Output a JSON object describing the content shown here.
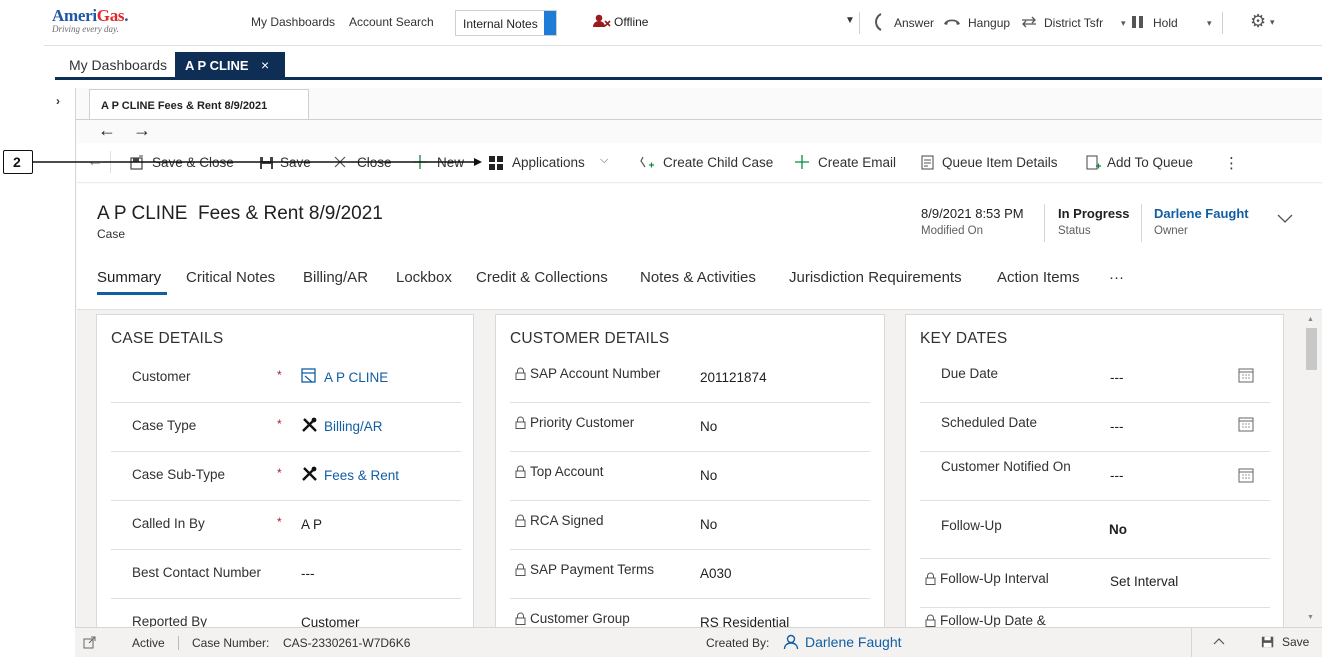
{
  "topbar": {
    "brand_ameri": "Ameri",
    "brand_gas": "Gas",
    "brand_dot": ".",
    "tagline": "Driving every day.",
    "my_dashboards": "My Dashboards",
    "account_search": "Account Search",
    "internal_notes": "Internal Notes",
    "offline": "Offline",
    "answer": "Answer",
    "hangup": "Hangup",
    "district_tsfr": "District Tsfr",
    "hold": "Hold"
  },
  "apptabs": {
    "dashboards": "My Dashboards",
    "case_tab": "A P CLINE",
    "close": "×"
  },
  "session": {
    "tab_title": "A P CLINE  Fees & Rent 8/9/2021",
    "back": "←",
    "forward": "→"
  },
  "commands": {
    "save_close": "Save & Close",
    "save": "Save",
    "close": "Close",
    "new": "New",
    "applications": "Applications",
    "create_child_case": "Create Child Case",
    "create_email": "Create Email",
    "queue_item_details": "Queue Item Details",
    "add_to_queue": "Add To Queue",
    "more": "⋮"
  },
  "header": {
    "title": "A P CLINE  Fees & Rent 8/9/2021",
    "entity": "Case",
    "modified_on_value": "8/9/2021 8:53 PM",
    "modified_on_label": "Modified On",
    "status_value": "In Progress",
    "status_label": "Status",
    "owner_value": "Darlene Faught",
    "owner_label": "Owner"
  },
  "tabs": [
    "Summary",
    "Critical Notes",
    "Billing/AR",
    "Lockbox",
    "Credit & Collections",
    "Notes & Activities",
    "Jurisdiction Requirements",
    "Action Items",
    "···"
  ],
  "case_details": {
    "title": "CASE DETAILS",
    "rows": [
      {
        "label": "Customer",
        "required": "*",
        "value": "A P CLINE"
      },
      {
        "label": "Case Type",
        "required": "*",
        "value": "Billing/AR"
      },
      {
        "label": "Case Sub-Type",
        "required": "*",
        "value": "Fees & Rent"
      },
      {
        "label": "Called In By",
        "required": "*",
        "value": "A P"
      },
      {
        "label": "Best Contact Number",
        "required": "",
        "value": "---"
      },
      {
        "label": "Reported By",
        "required": "",
        "value": "Customer"
      }
    ]
  },
  "customer_details": {
    "title": "CUSTOMER DETAILS",
    "rows": [
      {
        "label": "SAP Account Number",
        "value": "201121874"
      },
      {
        "label": "Priority Customer",
        "value": "No"
      },
      {
        "label": "Top Account",
        "value": "No"
      },
      {
        "label": "RCA Signed",
        "value": "No"
      },
      {
        "label": "SAP Payment Terms",
        "value": "A030"
      },
      {
        "label": "Customer Group",
        "value": "RS Residential"
      }
    ]
  },
  "key_dates": {
    "title": "KEY DATES",
    "rows": [
      {
        "label": "Due Date",
        "value": "---"
      },
      {
        "label": "Scheduled Date",
        "value": "---"
      },
      {
        "label": "Customer Notified On",
        "value": "---"
      },
      {
        "label": "Follow-Up",
        "value": "No"
      },
      {
        "label": "Follow-Up Interval",
        "value": "Set Interval"
      },
      {
        "label": "Follow-Up Date &",
        "value": ""
      }
    ]
  },
  "footer": {
    "status": "Active",
    "case_number_label": "Case Number:",
    "case_number": "CAS-2330261-W7D6K6",
    "created_by_label": "Created By:",
    "created_by": "Darlene Faught",
    "save": "Save"
  },
  "annotation": {
    "callout_number": "2"
  }
}
